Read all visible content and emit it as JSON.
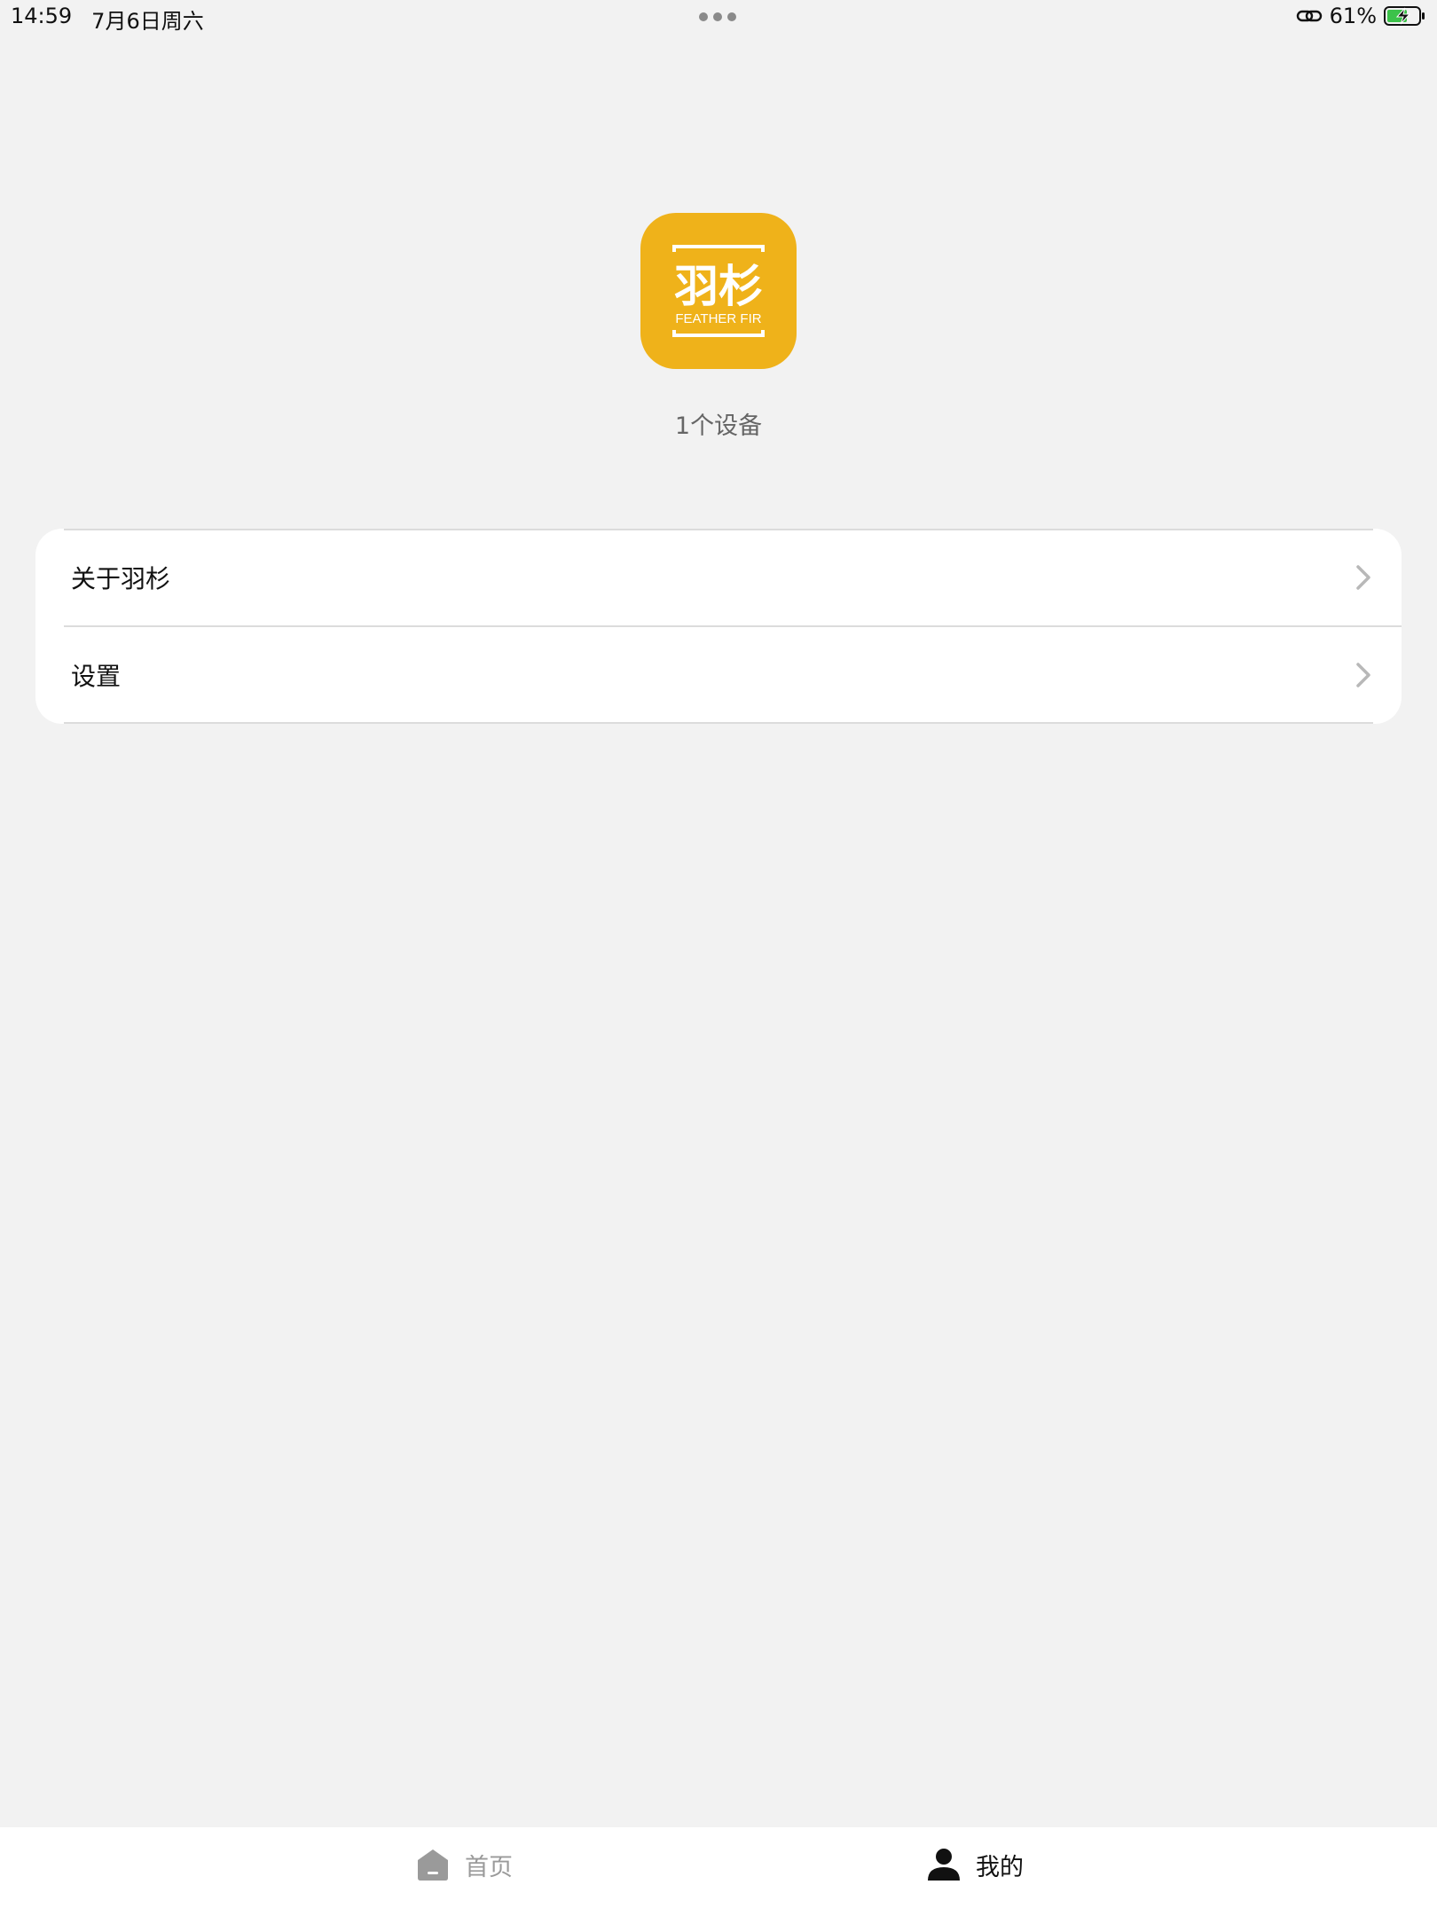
{
  "status_bar": {
    "time": "14:59",
    "date": "7月6日周六",
    "battery": "61%",
    "icons": [
      "link-icon",
      "battery-charging-icon"
    ]
  },
  "app": {
    "logo_text_cn": "羽杉",
    "logo_text_en": "FEATHER FIR",
    "logo_color": "#efb21a",
    "device_count": "1个设备"
  },
  "menu": {
    "items": [
      {
        "label": "关于羽杉",
        "icon": "chevron-right-icon"
      },
      {
        "label": "设置",
        "icon": "chevron-right-icon"
      }
    ]
  },
  "tab_bar": {
    "tabs": [
      {
        "label": "首页",
        "icon": "home-icon",
        "active": false
      },
      {
        "label": "我的",
        "icon": "person-icon",
        "active": true
      }
    ],
    "active_color": "#111111",
    "inactive_color": "#9a9a9a"
  }
}
